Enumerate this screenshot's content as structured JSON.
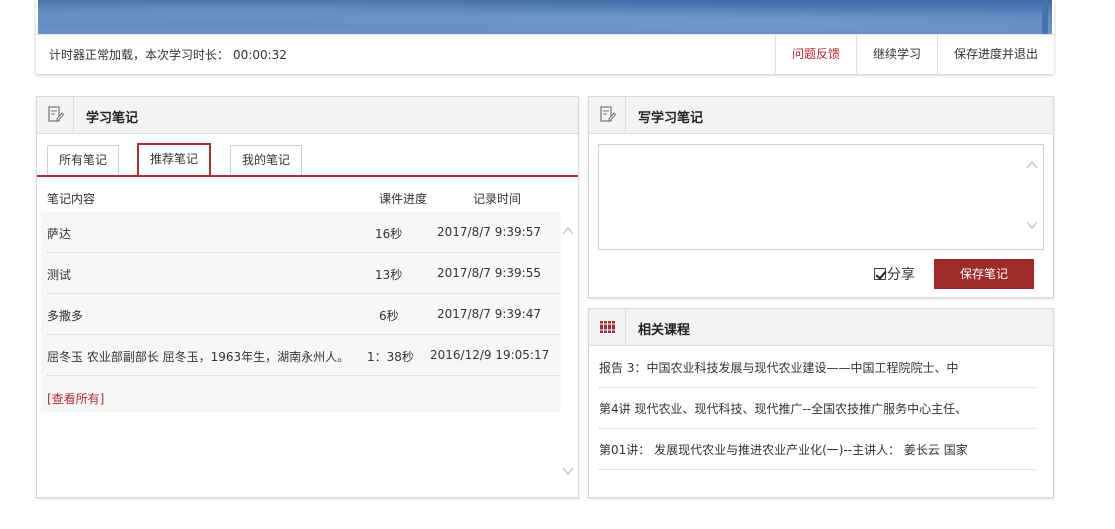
{
  "timer": {
    "label": "计时器正常加载，本次学习时长：",
    "time": "00:00:32"
  },
  "timer_actions": {
    "feedback": "问题反馈",
    "continue": "继续学习",
    "save_exit": "保存进度并退出"
  },
  "notes": {
    "title": "学习笔记",
    "tabs": [
      "所有笔记",
      "推荐笔记",
      "我的笔记"
    ],
    "active_tab": "推荐笔记",
    "columns": [
      "笔记内容",
      "课件进度",
      "记录时间"
    ],
    "rows": [
      {
        "content": "萨达",
        "progress": "16秒",
        "time": "2017/8/7 9:39:57"
      },
      {
        "content": "测试",
        "progress": "13秒",
        "time": "2017/8/7 9:39:55"
      },
      {
        "content": "多撒多",
        "progress": "6秒",
        "time": "2017/8/7 9:39:47"
      },
      {
        "content": "屈冬玉 农业部副部长 屈冬玉，1963年生，湖南永州人。",
        "progress": "1：38秒",
        "time": "2016/12/9 19:05:17"
      }
    ],
    "view_all": "[查看所有]"
  },
  "write": {
    "title": "写学习笔记",
    "textarea_value": "",
    "share_label": "分享",
    "share_checked": true,
    "save_label": "保存笔记"
  },
  "related": {
    "title": "相关课程",
    "items": [
      "报告 3：中国农业科技发展与现代农业建设——中国工程院院士、中",
      "第4讲 现代农业、现代科技、现代推广--全国农技推广服务中心主任、",
      "第01讲： 发展现代农业与推进农业产业化(一)--主讲人： 姜长云 国家"
    ]
  },
  "colors": {
    "accent": "#b52b2f",
    "save_button": "#9f2a2a",
    "video_blue": "#5b86bf"
  },
  "icons": [
    "note-edit-icon",
    "note-edit-icon",
    "library-books-icon",
    "scroll-up-icon",
    "scroll-down-icon",
    "checkbox-check-icon"
  ]
}
